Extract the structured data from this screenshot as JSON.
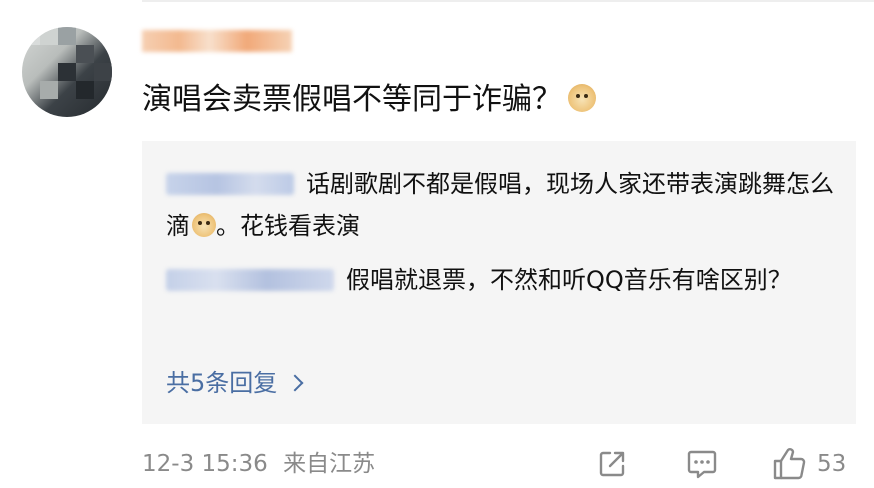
{
  "comment": {
    "text": "演唱会卖票假唱不等同于诈骗？",
    "emoji": "dog-emoji"
  },
  "replies": [
    {
      "text": "话剧歌剧不都是假唱，现场人家还带表演跳舞怎么滴",
      "text_after_emoji": "。花钱看表演"
    },
    {
      "text": "假唱就退票，不然和听QQ音乐有啥区别？"
    }
  ],
  "more_replies_label": "共5条回复",
  "meta": {
    "date_time": "12-3 15:36",
    "location": "来自江苏"
  },
  "actions": {
    "like_count": "53"
  },
  "colors": {
    "reply_box_bg": "#f5f5f5",
    "link_blue": "#4a6ea3",
    "meta_gray": "#8a8a8a"
  }
}
